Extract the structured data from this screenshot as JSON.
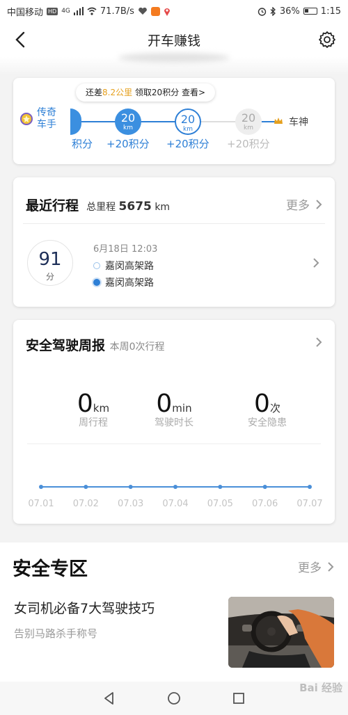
{
  "status_bar": {
    "carrier": "中国移动",
    "hd": "HD",
    "net": "4G",
    "speed": "71.7B/s",
    "battery": "36%",
    "time": "1:15"
  },
  "header": {
    "title": "开车赚钱"
  },
  "progress": {
    "tip_prefix": "还差",
    "tip_distance": "8.2公里",
    "tip_suffix": " 领取20积分 查看>",
    "current_level": "传奇车手",
    "next_level": "车神",
    "partial_points": "积分",
    "nodes": [
      {
        "value": "20",
        "unit": "km",
        "points": "+20积分",
        "state": "done"
      },
      {
        "value": "20",
        "unit": "km",
        "points": "+20积分",
        "state": "current"
      },
      {
        "value": "20",
        "unit": "km",
        "points": "+20积分",
        "state": "future"
      }
    ]
  },
  "recent": {
    "title": "最近行程",
    "total_label": "总里程",
    "total_value": "5675",
    "total_unit": "km",
    "more": "更多",
    "score": "91",
    "score_unit": "分",
    "time": "6月18日 12:03",
    "start": "嘉闵高架路",
    "end": "嘉闵高架路"
  },
  "weekly": {
    "title": "安全驾驶周报",
    "subtitle": "本周0次行程",
    "stats": [
      {
        "value": "0",
        "unit": "km",
        "label": "周行程"
      },
      {
        "value": "0",
        "unit": "min",
        "label": "驾驶时长"
      },
      {
        "value": "0",
        "unit": "次",
        "label": "安全隐患"
      }
    ]
  },
  "chart_data": {
    "type": "line",
    "categories": [
      "07.01",
      "07.02",
      "07.03",
      "07.04",
      "07.05",
      "07.06",
      "07.07"
    ],
    "values": [
      0,
      0,
      0,
      0,
      0,
      0,
      0
    ],
    "title": "",
    "xlabel": "",
    "ylabel": "",
    "color": "#4a8fd8",
    "grid": false
  },
  "zone": {
    "title": "安全专区",
    "more": "更多",
    "article_title": "女司机必备7大驾驶技巧",
    "article_sub": "告别马路杀手称号"
  },
  "watermark": "Bai 经验",
  "colors": {
    "accent": "#2d7fd6",
    "gold": "#e5a01e"
  }
}
